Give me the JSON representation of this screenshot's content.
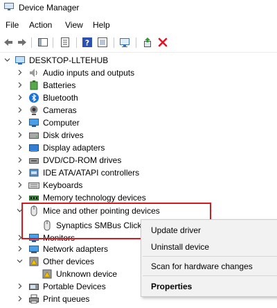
{
  "window": {
    "title": "Device Manager",
    "app_icon": "device-manager-icon"
  },
  "menu": [
    "File",
    "Action",
    "View",
    "Help"
  ],
  "toolbar": {
    "buttons": [
      "back-arrow-icon",
      "forward-arrow-icon",
      "show-hide-pane-icon",
      "properties-icon",
      "help-icon",
      "show-hidden-icon",
      "scan-hardware-icon",
      "update-driver-icon",
      "uninstall-icon"
    ]
  },
  "tree": {
    "root": "DESKTOP-LLTEHUB",
    "items": [
      {
        "label": "Audio inputs and outputs",
        "icon": "speaker-icon"
      },
      {
        "label": "Batteries",
        "icon": "battery-icon"
      },
      {
        "label": "Bluetooth",
        "icon": "bluetooth-icon"
      },
      {
        "label": "Cameras",
        "icon": "camera-icon"
      },
      {
        "label": "Computer",
        "icon": "computer-icon"
      },
      {
        "label": "Disk drives",
        "icon": "disk-icon"
      },
      {
        "label": "Display adapters",
        "icon": "display-adapter-icon"
      },
      {
        "label": "DVD/CD-ROM drives",
        "icon": "dvd-icon"
      },
      {
        "label": "IDE ATA/ATAPI controllers",
        "icon": "ide-controller-icon"
      },
      {
        "label": "Keyboards",
        "icon": "keyboard-icon"
      },
      {
        "label": "Memory technology devices",
        "icon": "memory-icon"
      },
      {
        "label": "Mice and other pointing devices",
        "icon": "mouse-icon",
        "expanded": true
      },
      {
        "label": "Synaptics SMBus ClickPad",
        "icon": "mouse-icon",
        "child": true,
        "selected": true
      },
      {
        "label": "Monitors",
        "icon": "monitor-icon"
      },
      {
        "label": "Network adapters",
        "icon": "network-icon"
      },
      {
        "label": "Other devices",
        "icon": "other-devices-icon",
        "expanded": true
      },
      {
        "label": "Unknown device",
        "icon": "unknown-device-icon",
        "child": true
      },
      {
        "label": "Portable Devices",
        "icon": "portable-device-icon"
      },
      {
        "label": "Print queues",
        "icon": "printer-icon"
      }
    ]
  },
  "context_menu": {
    "items": [
      "Update driver",
      "Uninstall device",
      "Scan for hardware changes",
      "Properties"
    ]
  },
  "colors": {
    "highlight_border": "#d6181f",
    "selection": "#cce8ff",
    "uninstall_red": "#e81123"
  }
}
